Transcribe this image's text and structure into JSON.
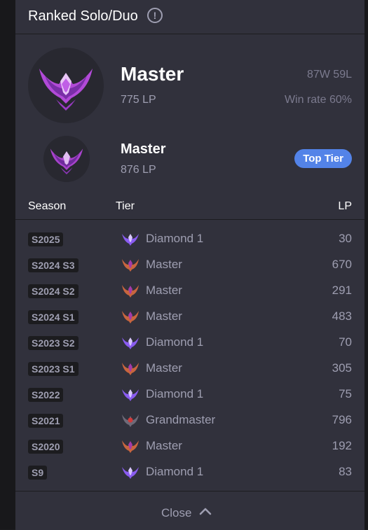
{
  "header": {
    "title": "Ranked Solo/Duo",
    "info_icon": "info-icon"
  },
  "current": {
    "tier": "Master",
    "lp": "775 LP",
    "record": "87W 59L",
    "win_rate": "Win rate 60%"
  },
  "peak": {
    "tier": "Master",
    "lp": "876 LP",
    "badge": "Top Tier"
  },
  "table": {
    "headers": {
      "season": "Season",
      "tier": "Tier",
      "lp": "LP"
    },
    "rows": [
      {
        "season": "S2025",
        "tier": "Diamond 1",
        "lp": "30",
        "icon": "diamond"
      },
      {
        "season": "S2024 S3",
        "tier": "Master",
        "lp": "670",
        "icon": "master"
      },
      {
        "season": "S2024 S2",
        "tier": "Master",
        "lp": "291",
        "icon": "master"
      },
      {
        "season": "S2024 S1",
        "tier": "Master",
        "lp": "483",
        "icon": "master"
      },
      {
        "season": "S2023 S2",
        "tier": "Diamond 1",
        "lp": "70",
        "icon": "diamond"
      },
      {
        "season": "S2023 S1",
        "tier": "Master",
        "lp": "305",
        "icon": "master"
      },
      {
        "season": "S2022",
        "tier": "Diamond 1",
        "lp": "75",
        "icon": "diamond"
      },
      {
        "season": "S2021",
        "tier": "Grandmaster",
        "lp": "796",
        "icon": "grandmaster"
      },
      {
        "season": "S2020",
        "tier": "Master",
        "lp": "192",
        "icon": "master"
      },
      {
        "season": "S9",
        "tier": "Diamond 1",
        "lp": "83",
        "icon": "diamond"
      }
    ]
  },
  "footer": {
    "close_label": "Close"
  },
  "colors": {
    "background": "#31313c",
    "accent": "#5383e8",
    "diamond": "#8a5cf0",
    "master": "#c8653f",
    "grandmaster": "#d13a3a"
  }
}
